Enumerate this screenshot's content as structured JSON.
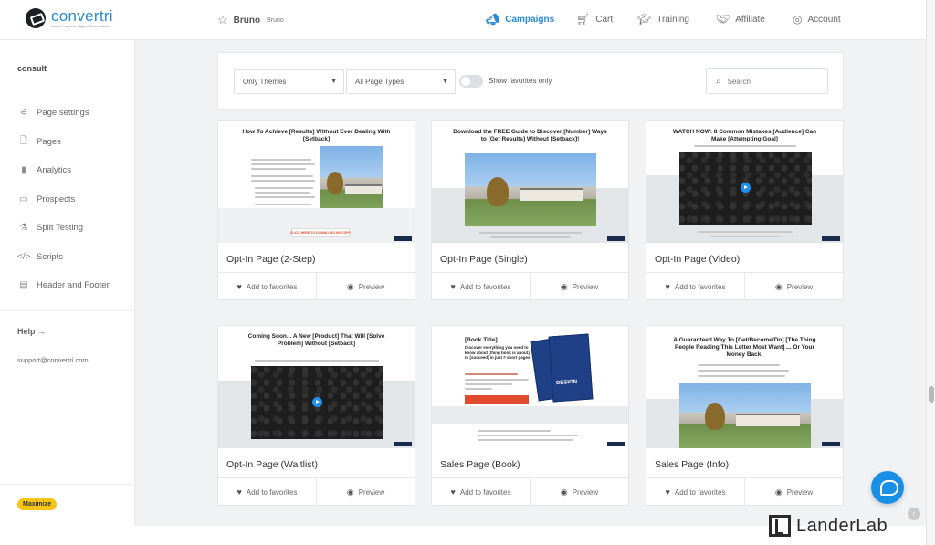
{
  "brand": {
    "name": "convertri",
    "tagline": "Faster Funnels, Higher Conversions"
  },
  "breadcrumb": {
    "project": "Bruno",
    "owner": "Bruno"
  },
  "nav": [
    {
      "label": "Campaigns",
      "icon": "megaphone-icon",
      "active": true
    },
    {
      "label": "Cart",
      "icon": "cart-icon",
      "active": false
    },
    {
      "label": "Training",
      "icon": "graduation-cap-icon",
      "active": false
    },
    {
      "label": "Affiliate",
      "icon": "handshake-icon",
      "active": false
    },
    {
      "label": "Account",
      "icon": "user-circle-icon",
      "active": false
    }
  ],
  "sidebar": {
    "title": "consult",
    "items": [
      {
        "label": "Page settings",
        "icon": "sliders-icon"
      },
      {
        "label": "Pages",
        "icon": "document-icon"
      },
      {
        "label": "Analytics",
        "icon": "bar-chart-icon"
      },
      {
        "label": "Prospects",
        "icon": "briefcase-icon"
      },
      {
        "label": "Split Testing",
        "icon": "flask-icon"
      },
      {
        "label": "Scripts",
        "icon": "code-icon"
      },
      {
        "label": "Header and Footer",
        "icon": "layout-icon"
      }
    ],
    "help": "Help →",
    "support": "support@convertri.com",
    "maximize": "Maximize"
  },
  "filters": {
    "theme_select": "Only Themes",
    "type_select": "All Page Types",
    "favorites_toggle_label": "Show favorites only",
    "favorites_only": false,
    "search_placeholder": "Search"
  },
  "actions": {
    "favorite": "Add to favorites",
    "preview": "Preview"
  },
  "templates": [
    {
      "name": "Opt-In Page (2-Step)",
      "headline": "How To Achieve [Results] Without Ever Dealing With [Setback]",
      "cta": "CLICK HERE TO DOWNLOAD MY COPY"
    },
    {
      "name": "Opt-In Page (Single)",
      "headline": "Download the FREE Guide to Discover [Number] Ways to [Get Results] Without [Setback]!"
    },
    {
      "name": "Opt-In Page (Video)",
      "headline": "WATCH NOW: 8 Common Mistakes [Audience] Can Make [Attempting Goal]"
    },
    {
      "name": "Opt-In Page (Waitlist)",
      "headline": "Coming Soon... A New [Product] That Will [Solve Problem] Without [Setback]"
    },
    {
      "name": "Sales Page (Book)",
      "headline": "[Book Title]",
      "subhead": "Discover everything you need to know about [thing book is about] to [succeed] in just # short pages",
      "book_cover": "DESIGN"
    },
    {
      "name": "Sales Page (Info)",
      "headline": "A Guaranteed Way To [Get/Become/Do] [The Thing People Reading This Letter Most Want] ... Or Your Money Back!"
    }
  ],
  "watermark": "LanderLab",
  "colors": {
    "accent": "#2a8bd6",
    "maximize": "#f5c518",
    "chat": "#1a8fe6",
    "cta_red": "#e24a2e"
  }
}
